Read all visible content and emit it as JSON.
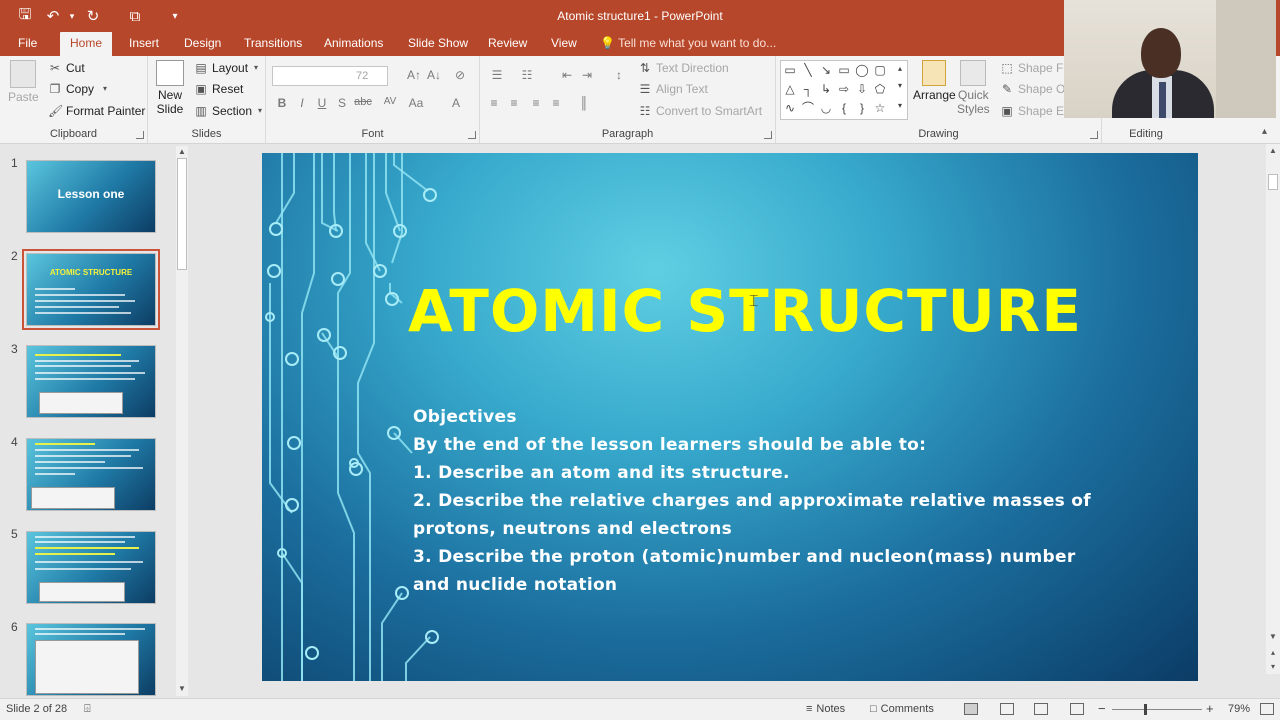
{
  "window": {
    "title": "Atomic structure1 - PowerPoint"
  },
  "qat": {
    "save": "save-icon",
    "undo": "undo-icon",
    "redo": "redo-icon",
    "start": "present-from-start-icon",
    "customize": "▾"
  },
  "tabs": [
    "File",
    "Home",
    "Insert",
    "Design",
    "Transitions",
    "Animations",
    "Slide Show",
    "Review",
    "View"
  ],
  "active_tab": "Home",
  "tell_me": "Tell me what you want to do...",
  "ribbon": {
    "clipboard": {
      "paste": "Paste",
      "cut": "Cut",
      "copy": "Copy",
      "format_painter": "Format Painter",
      "label": "Clipboard"
    },
    "slides": {
      "new_slide_1": "New",
      "new_slide_2": "Slide",
      "layout": "Layout",
      "reset": "Reset",
      "section": "Section",
      "label": "Slides"
    },
    "font": {
      "font_size": "72",
      "bold": "B",
      "italic": "I",
      "underline": "U",
      "shadow": "S",
      "strike": "abc",
      "spacing": "AV",
      "case": "Aa",
      "color": "A",
      "label": "Font"
    },
    "paragraph": {
      "text_direction": "Text Direction",
      "align_text": "Align Text",
      "smartart": "Convert to SmartArt",
      "label": "Paragraph"
    },
    "drawing": {
      "arrange": "Arrange",
      "quick_styles_1": "Quick",
      "quick_styles_2": "Styles",
      "shape_fill": "Shape Fill",
      "shape_outline": "Shape Ou",
      "shape_effects": "Shape Effe",
      "label": "Drawing"
    },
    "editing": {
      "label": "Editing"
    }
  },
  "thumbnails": [
    {
      "num": "1",
      "title": "Lesson one"
    },
    {
      "num": "2",
      "title": "ATOMIC STRUCTURE"
    },
    {
      "num": "3",
      "title": ""
    },
    {
      "num": "4",
      "title": ""
    },
    {
      "num": "5",
      "title": ""
    },
    {
      "num": "6",
      "title": ""
    }
  ],
  "slide": {
    "title": "ATOMIC STRUCTURE",
    "objectives": "Objectives",
    "intro": "By the end of the lesson learners should be able to:",
    "item1": "1. Describe an atom and its structure.",
    "item2": "2. Describe the relative charges and approximate relative masses of protons, neutrons and electrons",
    "item3": "3. Describe the proton (atomic)number and nucleon(mass) number and nuclide notation"
  },
  "status": {
    "slide_counter": "Slide 2 of 28",
    "notes": "Notes",
    "comments": "Comments",
    "zoom": "79%",
    "zoom_minus": "−",
    "zoom_plus": "+"
  },
  "colors": {
    "titlebar": "#b7472a",
    "slide_title": "#ffff00",
    "selection": "#c9543a"
  }
}
